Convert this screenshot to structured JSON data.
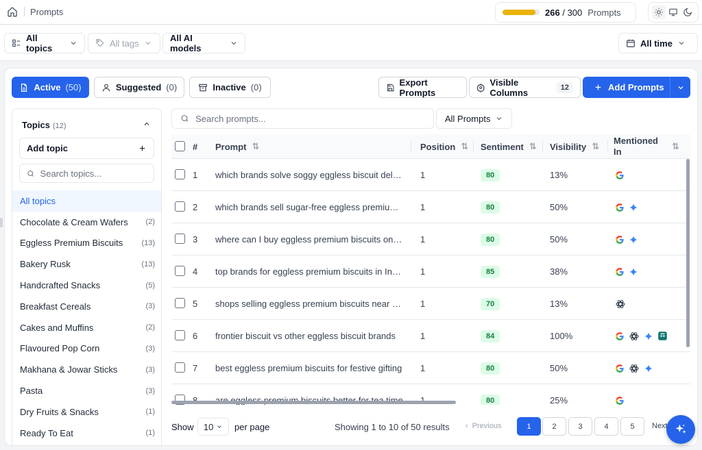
{
  "header": {
    "breadcrumb": "Prompts",
    "usage": {
      "used": "266",
      "separator": "/",
      "total": "300",
      "label": "Prompts",
      "fraction": 0.887
    }
  },
  "filters": {
    "topics": "All topics",
    "tags": "All tags",
    "models": "All AI models",
    "time": "All time"
  },
  "tabs": [
    {
      "label": "Active",
      "count": "(50)"
    },
    {
      "label": "Suggested",
      "count": "(0)"
    },
    {
      "label": "Inactive",
      "count": "(0)"
    }
  ],
  "actions": {
    "export": "Export Prompts",
    "columns": "Visible Columns",
    "columns_count": "12",
    "add": "Add Prompts"
  },
  "sidebar": {
    "title": "Topics",
    "count": "(12)",
    "add_topic": "Add topic",
    "search_placeholder": "Search topics...",
    "items": [
      {
        "label": "All topics",
        "count": ""
      },
      {
        "label": "Chocolate & Cream Wafers",
        "count": "(2)"
      },
      {
        "label": "Eggless Premium Biscuits",
        "count": "(13)"
      },
      {
        "label": "Bakery Rusk",
        "count": "(13)"
      },
      {
        "label": "Handcrafted Snacks",
        "count": "(5)"
      },
      {
        "label": "Breakfast Cereals",
        "count": "(3)"
      },
      {
        "label": "Cakes and Muffins",
        "count": "(2)"
      },
      {
        "label": "Flavoured Pop Corn",
        "count": "(3)"
      },
      {
        "label": "Makhana & Jowar Sticks",
        "count": "(3)"
      },
      {
        "label": "Pasta",
        "count": "(3)"
      },
      {
        "label": "Dry Fruits & Snacks",
        "count": "(1)"
      },
      {
        "label": "Ready To Eat",
        "count": "(1)"
      }
    ]
  },
  "table": {
    "search_placeholder": "Search prompts...",
    "filter": "All Prompts",
    "columns": {
      "num": "#",
      "prompt": "Prompt",
      "position": "Position",
      "sentiment": "Sentiment",
      "visibility": "Visibility",
      "mentioned1": "Mentioned",
      "mentioned2": "In"
    },
    "rows": [
      {
        "n": "1",
        "prompt": "which brands solve soggy eggless biscuit delivery",
        "position": "1",
        "sentiment": "80",
        "visibility": "13%",
        "mentioned": [
          "google"
        ]
      },
      {
        "n": "2",
        "prompt": "which brands sell sugar-free eggless premium biscuits",
        "position": "1",
        "sentiment": "80",
        "visibility": "50%",
        "mentioned": [
          "google",
          "gemini"
        ]
      },
      {
        "n": "3",
        "prompt": "where can I buy eggless premium biscuits online",
        "position": "1",
        "sentiment": "80",
        "visibility": "50%",
        "mentioned": [
          "google",
          "gemini"
        ]
      },
      {
        "n": "4",
        "prompt": "top brands for eggless premium biscuits in India",
        "position": "1",
        "sentiment": "85",
        "visibility": "38%",
        "mentioned": [
          "google",
          "gemini"
        ]
      },
      {
        "n": "5",
        "prompt": "shops selling eggless premium biscuits near me",
        "position": "1",
        "sentiment": "70",
        "visibility": "13%",
        "mentioned": [
          "openai"
        ]
      },
      {
        "n": "6",
        "prompt": "frontier biscuit vs other eggless biscuit brands",
        "position": "1",
        "sentiment": "84",
        "visibility": "100%",
        "mentioned": [
          "google",
          "openai",
          "gemini",
          "copilot"
        ]
      },
      {
        "n": "7",
        "prompt": "best eggless premium biscuits for festive gifting",
        "position": "1",
        "sentiment": "80",
        "visibility": "50%",
        "mentioned": [
          "google",
          "openai",
          "gemini"
        ]
      },
      {
        "n": "8",
        "prompt": "are eggless premium biscuits better for tea time",
        "position": "1",
        "sentiment": "80",
        "visibility": "25%",
        "mentioned": [
          "google"
        ]
      }
    ]
  },
  "footer": {
    "show": "Show",
    "per_page_value": "10",
    "per_page_label": "per page",
    "results": "Showing 1 to 10 of 50 results",
    "previous": "Previous",
    "pages": [
      "1",
      "2",
      "3",
      "4",
      "5"
    ],
    "next": "Next"
  },
  "colors": {
    "accent": "#2563eb",
    "usage": "#eab308",
    "sentiment_bg": "#dcfce7",
    "sentiment_fg": "#15803d"
  }
}
